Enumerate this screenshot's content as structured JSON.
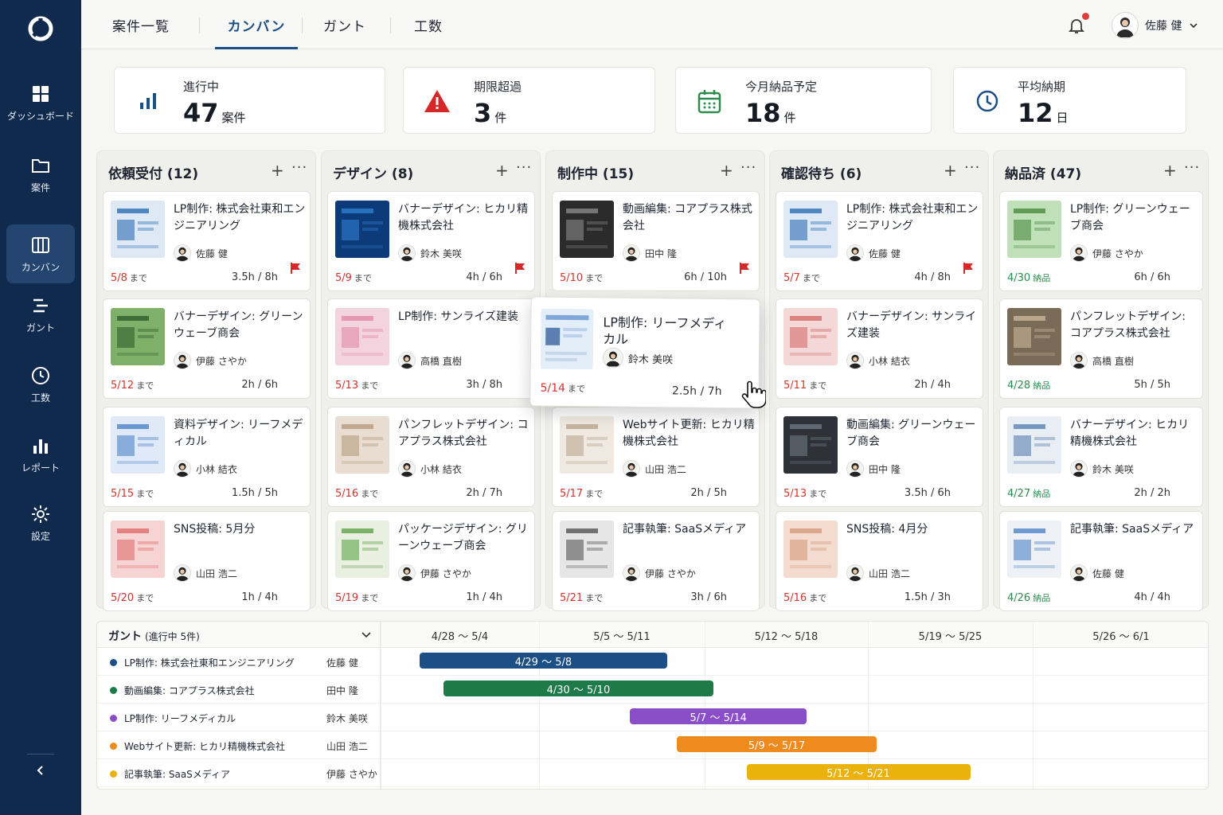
{
  "nav": {
    "items": [
      {
        "label": "ダッシュボード",
        "icon": "grid-icon"
      },
      {
        "label": "案件",
        "icon": "folder-icon"
      },
      {
        "label": "カンバン",
        "icon": "kanban-icon"
      },
      {
        "label": "ガント",
        "icon": "gantt-icon"
      },
      {
        "label": "工数",
        "icon": "clock-icon"
      },
      {
        "label": "レポート",
        "icon": "bar-chart-icon"
      },
      {
        "label": "設定",
        "icon": "gear-icon"
      }
    ],
    "active": "カンバン"
  },
  "tabs": [
    {
      "label": "案件一覧"
    },
    {
      "label": "カンバン"
    },
    {
      "label": "ガント"
    },
    {
      "label": "工数"
    }
  ],
  "user": {
    "name": "佐藤 健"
  },
  "stats": [
    {
      "label": "進行中",
      "value": "47",
      "unit": "案件",
      "color": "#1b4f86"
    },
    {
      "label": "期限超過",
      "value": "3",
      "unit": "件",
      "color": "#d62828"
    },
    {
      "label": "今月納品予定",
      "value": "18",
      "unit": "件",
      "color": "#2e8b4c"
    },
    {
      "label": "平均納期",
      "value": "12",
      "unit": "日",
      "color": "#1b4f86"
    }
  ],
  "columns": [
    {
      "title": "依頼受付 (12)",
      "cards": [
        {
          "title": "LP制作: 株式会社東和エンジニアリング",
          "person": "佐藤 健",
          "due": "5/8",
          "due_suffix": "まで",
          "hours": "3.5h / 8h",
          "flag": true
        },
        {
          "title": "バナーデザイン: グリーンウェーブ商会",
          "person": "伊藤 さやか",
          "due": "5/12",
          "due_suffix": "まで",
          "hours": "2h / 6h"
        },
        {
          "title": "資料デザイン: リーフメディカル",
          "person": "小林 結衣",
          "due": "5/15",
          "due_suffix": "まで",
          "hours": "1.5h / 5h"
        },
        {
          "title": "SNS投稿: 5月分",
          "person": "山田 浩二",
          "due": "5/20",
          "due_suffix": "まで",
          "hours": "1h / 4h"
        }
      ]
    },
    {
      "title": "デザイン (8)",
      "cards": [
        {
          "title": "バナーデザイン: ヒカリ精機株式会社",
          "person": "鈴木 美咲",
          "due": "5/9",
          "due_suffix": "まで",
          "hours": "4h / 6h",
          "flag": true
        },
        {
          "title": "LP制作: サンライズ建装",
          "person": "高橋 直樹",
          "due": "5/13",
          "due_suffix": "まで",
          "hours": "3h / 8h"
        },
        {
          "title": "パンフレットデザイン: コアプラス株式会社",
          "person": "小林 結衣",
          "due": "5/16",
          "due_suffix": "まで",
          "hours": "2h / 7h"
        },
        {
          "title": "パッケージデザイン: グリーンウェーブ商会",
          "person": "伊藤 さやか",
          "due": "5/19",
          "due_suffix": "まで",
          "hours": "1h / 4h"
        }
      ]
    },
    {
      "title": "制作中 (15)",
      "cards": [
        {
          "title": "動画編集: コアプラス株式会社",
          "person": "田中 隆",
          "due": "5/10",
          "due_suffix": "まで",
          "hours": "6h / 10h",
          "flag": true
        },
        {
          "title": "Webサイト更新: ヒカリ精機株式会社",
          "person": "山田 浩二",
          "due": "5/17",
          "due_suffix": "まで",
          "hours": "2h / 5h"
        },
        {
          "title": "記事執筆: SaaSメディア",
          "person": "伊藤 さやか",
          "due": "5/21",
          "due_suffix": "まで",
          "hours": "3h / 6h"
        }
      ]
    },
    {
      "title": "確認待ち (6)",
      "cards": [
        {
          "title": "LP制作: 株式会社東和エンジニアリング",
          "person": "佐藤 健",
          "due": "5/7",
          "due_suffix": "まで",
          "hours": "4h / 8h",
          "flag": true
        },
        {
          "title": "バナーデザイン: サンライズ建装",
          "person": "小林 結衣",
          "due": "5/11",
          "due_suffix": "まで",
          "hours": "2h / 4h"
        },
        {
          "title": "動画編集: グリーンウェーブ商会",
          "person": "田中 隆",
          "due": "5/13",
          "due_suffix": "まで",
          "hours": "3.5h / 6h"
        },
        {
          "title": "SNS投稿: 4月分",
          "person": "山田 浩二",
          "due": "5/16",
          "due_suffix": "まで",
          "hours": "1.5h / 3h"
        }
      ]
    },
    {
      "title": "納品済 (47)",
      "cards": [
        {
          "title": "LP制作: グリーンウェーブ商会",
          "person": "伊藤 さやか",
          "due": "4/30",
          "due_suffix": "納品",
          "hours": "6h / 6h"
        },
        {
          "title": "パンフレットデザイン: コアプラス株式会社",
          "person": "高橋 直樹",
          "due": "4/28",
          "due_suffix": "納品",
          "hours": "5h / 5h"
        },
        {
          "title": "バナーデザイン: ヒカリ精機株式会社",
          "person": "鈴木 美咲",
          "due": "4/27",
          "due_suffix": "納品",
          "hours": "2h / 2h"
        },
        {
          "title": "記事執筆: SaaSメディア",
          "person": "佐藤 健",
          "due": "4/26",
          "due_suffix": "納品",
          "hours": "4h / 4h"
        }
      ]
    }
  ],
  "dragging_card": {
    "title": "LP制作: リーフメディカル",
    "person": "鈴木 美咲",
    "due": "5/14",
    "due_suffix": "まで",
    "hours": "2.5h / 7h"
  },
  "gantt": {
    "title": "ガント",
    "subtitle": "(進行中 5件)",
    "weeks": [
      "4/28 〜 5/4",
      "5/5 〜 5/11",
      "5/12 〜 5/18",
      "5/19 〜 5/25",
      "5/26 〜 6/1"
    ],
    "rows": [
      {
        "task": "LP制作: 株式会社東和エンジニアリング",
        "person": "佐藤 健",
        "range": "4/29 〜 5/8",
        "color": "#1b4f86",
        "start": "4/29",
        "end": "5/8"
      },
      {
        "task": "動画編集: コアプラス株式会社",
        "person": "田中 隆",
        "range": "4/30 〜 5/10",
        "color": "#1f7a4a",
        "start": "4/30",
        "end": "5/10"
      },
      {
        "task": "LP制作: リーフメディカル",
        "person": "鈴木 美咲",
        "range": "5/7 〜 5/14",
        "color": "#8a4fc8",
        "start": "5/7",
        "end": "5/14"
      },
      {
        "task": "Webサイト更新: ヒカリ精機株式会社",
        "person": "山田 浩二",
        "range": "5/9 〜 5/17",
        "color": "#ef8a1f",
        "start": "5/9",
        "end": "5/17"
      },
      {
        "task": "記事執筆: SaaSメディア",
        "person": "伊藤 さやか",
        "range": "5/12 〜 5/21",
        "color": "#e9b20c",
        "start": "5/12",
        "end": "5/21"
      }
    ]
  }
}
